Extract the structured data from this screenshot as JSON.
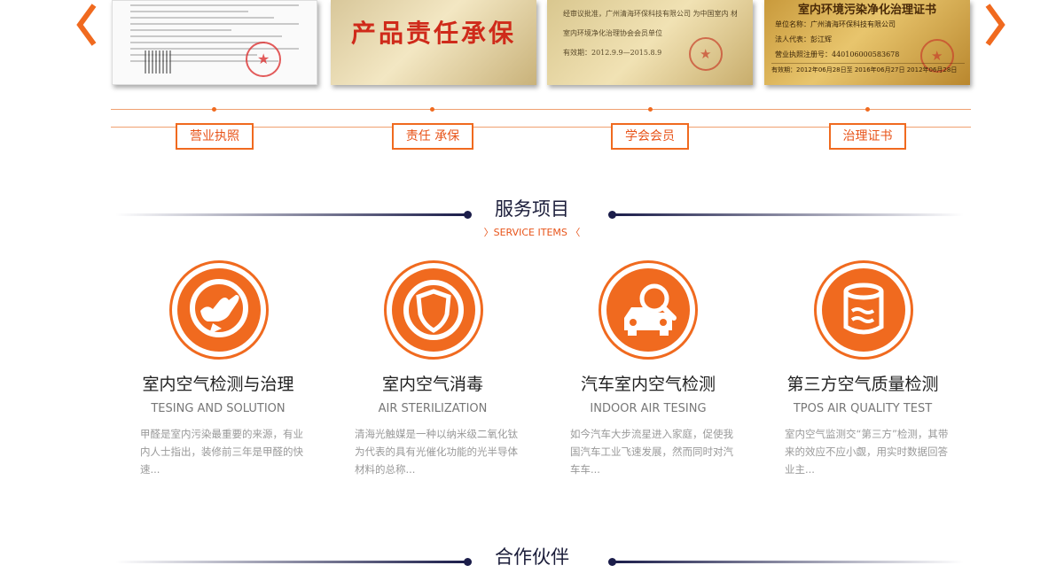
{
  "carousel": {
    "prev_icon": "chevron-left-icon",
    "next_icon": "chevron-right-icon",
    "accent_color": "#f06a1f",
    "cert2_text": "产品责任承保",
    "cert3_lines": [
      "经审议批准，广州清海环保科技有限公司  为中国室内  材质环保会",
      "室内环境净化治理协会会员单位",
      "有效期：2012.9.9—2015.8.9"
    ],
    "cert4_title": "室内环境污染净化治理证书",
    "cert4_lines": [
      "单位名称：广州清海环保科技有限公司",
      "法人代表：彭江辉",
      "营业执照注册号：440106000583678"
    ],
    "cert4_foot": "有效期：2012年06月28日至 2016年06月27日    2012年06月28日",
    "labels": [
      "营业执照",
      "责任 承保",
      "学会会员",
      "治理证书"
    ]
  },
  "services_section": {
    "title": "服务项目",
    "subtitle": "〉SERVICE ITEMS 〈",
    "items": [
      {
        "icon": "hand-badge-icon",
        "title": "室内空气检测与治理",
        "subtitle": "TESING AND SOLUTION",
        "description": "甲醛是室内污染最重要的来源，有业内人士指出，装修前三年是甲醛的快速..."
      },
      {
        "icon": "shield-icon",
        "title": "室内空气消毒",
        "subtitle": "AIR STERILIZATION",
        "description": "清海光触媒是一种以纳米级二氧化钛为代表的具有光催化功能的光半导体材料的总称..."
      },
      {
        "icon": "car-search-icon",
        "title": "汽车室内空气检测",
        "subtitle": "INDOOR AIR TESING",
        "description": "如今汽车大步流星进入家庭，促使我国汽车工业飞速发展，然而同时对汽车车..."
      },
      {
        "icon": "air-test-cup-icon",
        "title": "第三方空气质量检测",
        "subtitle": "TPOS AIR QUALITY TEST",
        "description": "室内空气监测交“第三方”检测，其带来的效应不应小觑，用实时数据回答业主..."
      }
    ]
  },
  "partners_section": {
    "title": "合作伙伴"
  }
}
